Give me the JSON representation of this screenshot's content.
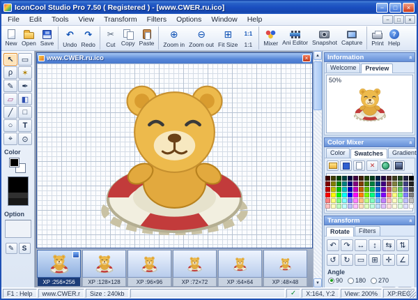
{
  "window": {
    "title": "IconCool Studio Pro 7.50 ( Registered ) - [www.CWER.ru.ico]",
    "controls": [
      {
        "name": "minimize-button",
        "glyph": "−"
      },
      {
        "name": "maximize-button",
        "glyph": "□"
      },
      {
        "name": "close-button",
        "glyph": "×",
        "close": true
      }
    ]
  },
  "menu": {
    "items": [
      "File",
      "Edit",
      "Tools",
      "View",
      "Transform",
      "Filters",
      "Options",
      "Window",
      "Help"
    ],
    "mdi_controls": [
      {
        "name": "mdi-minimize-button",
        "glyph": "−"
      },
      {
        "name": "mdi-restore-button",
        "glyph": "□"
      },
      {
        "name": "mdi-close-button",
        "glyph": "×"
      }
    ]
  },
  "toolbar": {
    "items": [
      {
        "name": "new-button",
        "label": "New",
        "icon": "new-icon"
      },
      {
        "name": "open-button",
        "label": "Open",
        "icon": "open-icon"
      },
      {
        "name": "save-button",
        "label": "Save",
        "icon": "save-icon"
      },
      {
        "name": "undo-button",
        "label": "Undo",
        "icon": "undo-icon",
        "group_start": true
      },
      {
        "name": "redo-button",
        "label": "Redo",
        "icon": "redo-icon"
      },
      {
        "name": "cut-button",
        "label": "Cut",
        "icon": "cut-icon",
        "group_start": true
      },
      {
        "name": "copy-button",
        "label": "Copy",
        "icon": "copy-icon"
      },
      {
        "name": "paste-button",
        "label": "Paste",
        "icon": "paste-icon"
      },
      {
        "name": "zoom-in-button",
        "label": "Zoom in",
        "icon": "zoom-in-icon",
        "group_start": true
      },
      {
        "name": "zoom-out-button",
        "label": "Zoom out",
        "icon": "zoom-out-icon"
      },
      {
        "name": "fit-size-button",
        "label": "Fit Size",
        "icon": "fit-size-icon"
      },
      {
        "name": "one-to-one-button",
        "label": "1:1",
        "icon": "one-to-one-icon"
      },
      {
        "name": "mixer-button",
        "label": "Mixer",
        "icon": "mixer-icon",
        "group_start": true
      },
      {
        "name": "ani-editor-button",
        "label": "Ani Editor",
        "icon": "ani-editor-icon"
      },
      {
        "name": "snapshot-button",
        "label": "Snapshot",
        "icon": "snapshot-icon"
      },
      {
        "name": "capture-button",
        "label": "Capture",
        "icon": "capture-icon"
      },
      {
        "name": "print-button",
        "label": "Print",
        "icon": "print-icon",
        "group_start": true
      },
      {
        "name": "help-button",
        "label": "Help",
        "icon": "help-icon"
      }
    ]
  },
  "left_panel": {
    "tools": [
      {
        "name": "select-tool",
        "icon": "select-icon",
        "selected": true
      },
      {
        "name": "marquee-tool",
        "icon": "marquee-icon"
      },
      {
        "name": "lasso-tool",
        "icon": "lasso-icon"
      },
      {
        "name": "magic-wand-tool",
        "icon": "magic-wand-icon"
      },
      {
        "name": "pencil-tool",
        "icon": "pencil-icon"
      },
      {
        "name": "brush-tool",
        "icon": "brush-icon"
      },
      {
        "name": "eraser-tool",
        "icon": "eraser-icon"
      },
      {
        "name": "fill-tool",
        "icon": "fill-icon"
      },
      {
        "name": "line-tool",
        "icon": "line-icon"
      },
      {
        "name": "rectangle-tool",
        "icon": "rectangle-icon"
      },
      {
        "name": "ellipse-tool",
        "icon": "ellipse-icon"
      },
      {
        "name": "text-tool",
        "icon": "text-icon"
      },
      {
        "name": "eyedropper-tool",
        "icon": "eyedropper-icon"
      },
      {
        "name": "zoom-tool",
        "icon": "zoom-tool-icon"
      }
    ],
    "color_label": "Color",
    "option_label": "Option",
    "pen_button_label": "✎",
    "s_button_label": "S"
  },
  "document": {
    "title": "www.CWER.ru.ico"
  },
  "filmstrip": {
    "items": [
      {
        "label": "XP :256×256",
        "selected": true
      },
      {
        "label": "XP :128×128"
      },
      {
        "label": "XP :96×96"
      },
      {
        "label": "XP :72×72"
      },
      {
        "label": "XP :64×64"
      },
      {
        "label": "XP :48×48"
      }
    ]
  },
  "right_panel": {
    "information": {
      "title": "Information",
      "tabs": [
        {
          "label": "Welcome"
        },
        {
          "label": "Preview",
          "active": true
        }
      ],
      "zoom_text": "50%"
    },
    "color_mixer": {
      "title": "Color Mixer",
      "tabs": [
        {
          "label": "Color"
        },
        {
          "label": "Swatches",
          "active": true
        },
        {
          "label": "Gradient"
        }
      ],
      "tools": [
        {
          "name": "open-palette-button",
          "icon": "folder-small-icon"
        },
        {
          "name": "save-palette-button",
          "icon": "floppy-small-icon"
        },
        {
          "name": "new-palette-button",
          "icon": "new-small-icon"
        },
        {
          "name": "delete-palette-button",
          "icon": "delete-small-icon"
        },
        {
          "name": "web-palette-button",
          "icon": "web-small-icon"
        },
        {
          "name": "system-palette-button",
          "icon": "system-small-icon"
        }
      ],
      "palette": [
        "#400000",
        "#404000",
        "#004000",
        "#004040",
        "#000040",
        "#400040",
        "#402000",
        "#204000",
        "#004020",
        "#002040",
        "#200040",
        "#402020",
        "#404020",
        "#204020",
        "#202040",
        "#000000",
        "#800000",
        "#808000",
        "#008000",
        "#008080",
        "#000080",
        "#800080",
        "#804000",
        "#408000",
        "#008040",
        "#004080",
        "#400080",
        "#804040",
        "#808040",
        "#408040",
        "#404080",
        "#202020",
        "#c00000",
        "#c0c000",
        "#00c000",
        "#00c0c0",
        "#0000c0",
        "#c000c0",
        "#c06000",
        "#60c000",
        "#00c060",
        "#0060c0",
        "#6000c0",
        "#c06060",
        "#c0c060",
        "#60c060",
        "#6060c0",
        "#404040",
        "#ff0000",
        "#ffff00",
        "#00ff00",
        "#00ffff",
        "#0000ff",
        "#ff00ff",
        "#ff8000",
        "#80ff00",
        "#00ff80",
        "#0080ff",
        "#8000ff",
        "#ff8080",
        "#ffff80",
        "#80ff80",
        "#8080ff",
        "#808080",
        "#ff8080",
        "#ffff80",
        "#80ff80",
        "#80ffff",
        "#8080ff",
        "#ff80ff",
        "#ffc080",
        "#c0ff80",
        "#80ffc0",
        "#80c0ff",
        "#c080ff",
        "#ffc0c0",
        "#ffffc0",
        "#c0ffc0",
        "#c0c0ff",
        "#c0c0c0",
        "#ffc0c0",
        "#ffffc0",
        "#c0ffc0",
        "#c0ffff",
        "#c0c0ff",
        "#ffc0ff",
        "#ffe0c0",
        "#e0ffc0",
        "#c0ffe0",
        "#c0e0ff",
        "#e0c0ff",
        "#ffe0e0",
        "#ffffe0",
        "#e0ffe0",
        "#e0e0ff",
        "#ffffff"
      ]
    },
    "transform": {
      "title": "Transform",
      "tabs": [
        {
          "label": "Rotate",
          "active": true
        },
        {
          "label": "Filters"
        }
      ],
      "buttons_row1": [
        {
          "name": "rotate-left-button",
          "icon": "rotate-left-icon"
        },
        {
          "name": "rotate-right-button",
          "icon": "rotate-right-icon"
        },
        {
          "name": "flip-horizontal-button",
          "icon": "flip-horizontal-icon"
        },
        {
          "name": "flip-vertical-button",
          "icon": "flip-vertical-icon"
        },
        {
          "name": "shear-horizontal-button",
          "icon": "shear-horizontal-icon"
        },
        {
          "name": "shear-vertical-button",
          "icon": "shear-vertical-icon"
        }
      ],
      "buttons_row2": [
        {
          "name": "rotate-ccw-90-button",
          "icon": "rotate-ccw-90-icon"
        },
        {
          "name": "rotate-cw-90-button",
          "icon": "rotate-cw-90-icon"
        },
        {
          "name": "crop-button",
          "icon": "crop-icon"
        },
        {
          "name": "resize-button",
          "icon": "resize-icon"
        },
        {
          "name": "center-button",
          "icon": "center-icon"
        },
        {
          "name": "free-rotate-button",
          "icon": "free-rotate-icon"
        }
      ],
      "angle_label": "Angle",
      "angles": [
        {
          "label": "90",
          "selected": true
        },
        {
          "label": "180"
        },
        {
          "label": "270"
        }
      ],
      "apply_buttons": [
        {
          "name": "rotate-ccw-button",
          "icon": "rotate-ccw-icon"
        },
        {
          "name": "rotate-cw-button",
          "icon": "rotate-cw-icon"
        }
      ]
    }
  },
  "status_bar": {
    "segments": [
      {
        "text": "F1 : Help"
      },
      {
        "text": "www.CWER.r"
      },
      {
        "text": "Size : 240kb"
      },
      {
        "text": "",
        "flex": true
      },
      {
        "text": "",
        "icon": "check-icon"
      },
      {
        "text": "X:164, Y:2"
      },
      {
        "text": "View: 200%"
      },
      {
        "text": "XP:REG"
      }
    ]
  }
}
